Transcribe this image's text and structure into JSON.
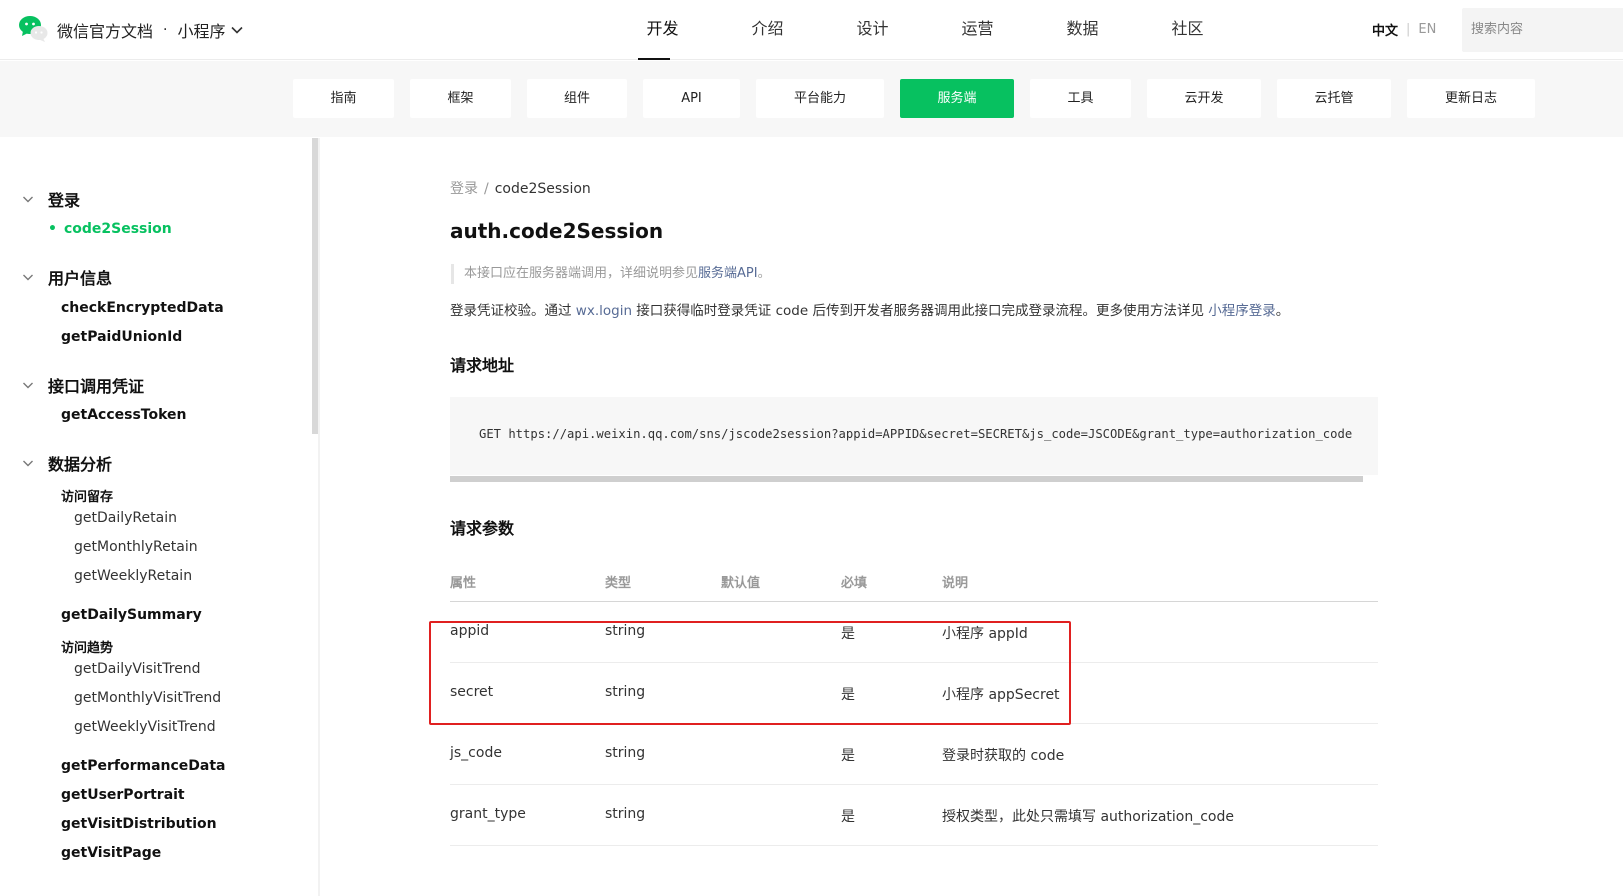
{
  "header": {
    "brand": "微信官方文档",
    "separator": "·",
    "product": "小程序",
    "product_chevron_icon": "chevron-down-icon",
    "nav": [
      "开发",
      "介绍",
      "设计",
      "运营",
      "数据",
      "社区"
    ],
    "nav_active": "开发",
    "lang_zh": "中文",
    "lang_sep": "|",
    "lang_en": "EN",
    "search_placeholder": "搜索内容"
  },
  "subnav": {
    "items": [
      "指南",
      "框架",
      "组件",
      "API",
      "平台能力",
      "服务端",
      "工具",
      "云开发",
      "云托管",
      "更新日志"
    ],
    "active": "服务端",
    "active_color": "#07c160"
  },
  "sidebar": {
    "groups": [
      {
        "label": "登录",
        "caret": "chevron-down-icon"
      },
      {
        "label": "用户信息",
        "caret": "chevron-down-icon"
      },
      {
        "label": "接口调用凭证",
        "caret": "chevron-down-icon"
      },
      {
        "label": "数据分析",
        "caret": "chevron-down-icon"
      }
    ],
    "active_item": "code2Session",
    "active_bullet": "•",
    "items": [
      "checkEncryptedData",
      "getPaidUnionId",
      "getAccessToken",
      "getDailySummary",
      "getPerformanceData",
      "getUserPortrait",
      "getVisitDistribution",
      "getVisitPage"
    ],
    "subgroups": [
      "访问留存",
      "访问趋势"
    ],
    "leaves": [
      "getDailyRetain",
      "getMonthlyRetain",
      "getWeeklyRetain",
      "getDailyVisitTrend",
      "getMonthlyVisitTrend",
      "getWeeklyVisitTrend"
    ]
  },
  "main": {
    "breadcrumb": {
      "parent": "登录",
      "sep": "/",
      "current": "code2Session"
    },
    "title": "auth.code2Session",
    "note_prefix": "本接口应在服务器端调用，详细说明参见",
    "note_link": "服务端API",
    "note_suffix": "。",
    "desc_part1": "登录凭证校验。通过 ",
    "desc_link1": "wx.login",
    "desc_part2": " 接口获得临时登录凭证 code 后传到开发者服务器调用此接口完成登录流程。更多使用方法详见 ",
    "desc_link2": "小程序登录",
    "desc_part3": "。",
    "section_url": "请求地址",
    "request_url": "GET https://api.weixin.qq.com/sns/jscode2session?appid=APPID&secret=SECRET&js_code=JSCODE&grant_type=authorization_code",
    "section_params": "请求参数",
    "table": {
      "headers": [
        "属性",
        "类型",
        "默认值",
        "必填",
        "说明"
      ],
      "rows": [
        [
          "appid",
          "string",
          "",
          "是",
          "小程序 appId"
        ],
        [
          "secret",
          "string",
          "",
          "是",
          "小程序 appSecret"
        ],
        [
          "js_code",
          "string",
          "",
          "是",
          "登录时获取的 code"
        ],
        [
          "grant_type",
          "string",
          "",
          "是",
          "授权类型，此处只需填写 authorization_code"
        ]
      ]
    },
    "highlight_color": "#e02020"
  }
}
